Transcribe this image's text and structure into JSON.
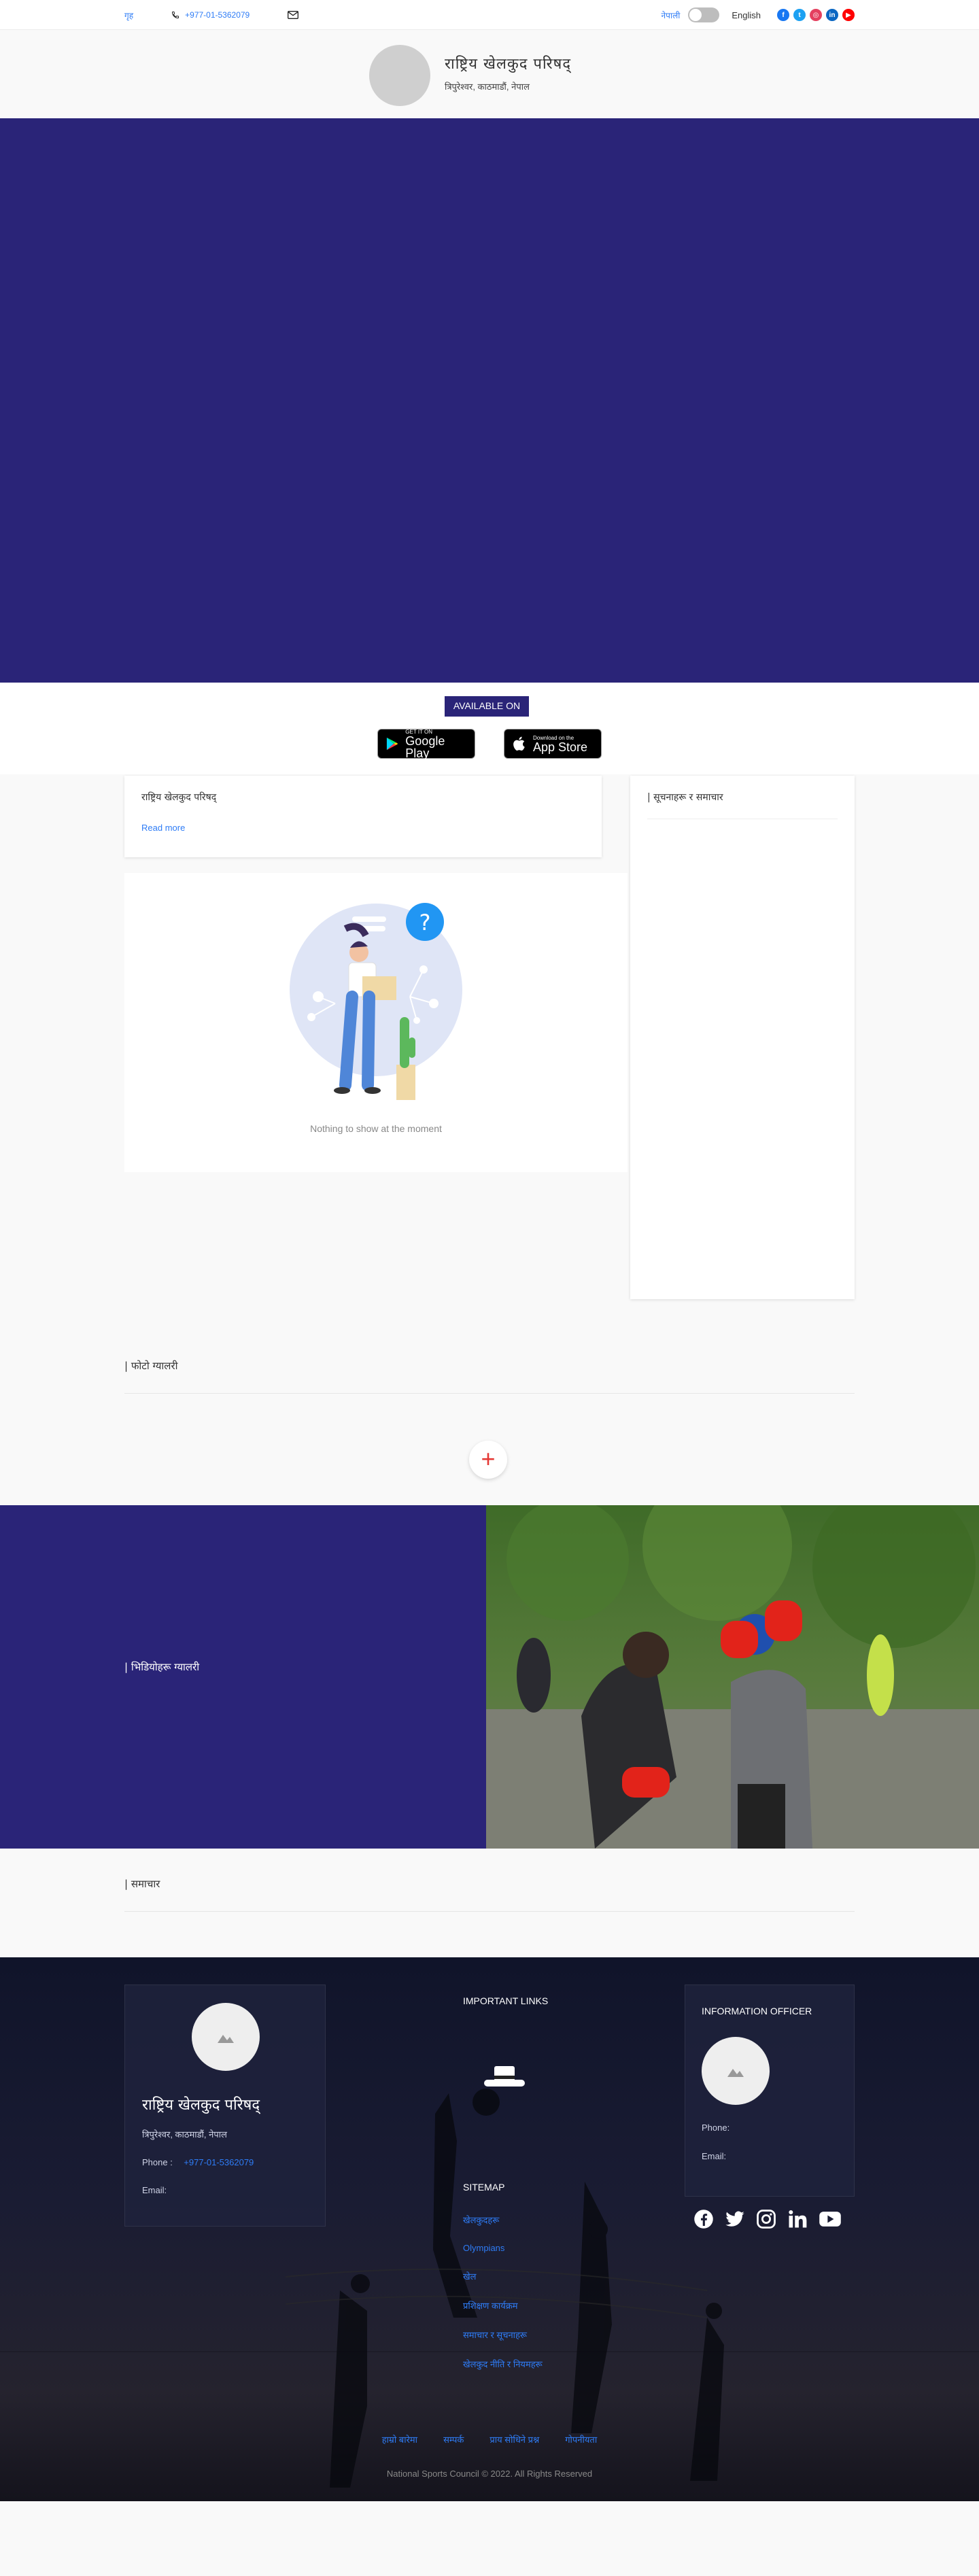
{
  "topbar": {
    "home": "गृह",
    "phone": "+977-01-5362079",
    "lang_native": "नेपाली",
    "lang_english": "English",
    "social": [
      "facebook-icon",
      "twitter-icon",
      "instagram-icon",
      "linkedin-icon",
      "youtube-icon"
    ],
    "social_letters": [
      "f",
      "t",
      "◎",
      "in",
      "▶"
    ],
    "social_colors": [
      "#1877f2",
      "#1da1f2",
      "#e4405f",
      "#0a66c2",
      "#ff0000"
    ]
  },
  "brand": {
    "title": "राष्ट्रिय खेलकुद परिषद्",
    "subtitle": "त्रिपुरेश्वर, काठमाडौं, नेपाल"
  },
  "app": {
    "available": "AVAILABLE ON",
    "google_small": "GET IT ON",
    "google_big": "Google Play",
    "apple_small": "Download on the",
    "apple_big": "App Store"
  },
  "notice": {
    "title": "राष्ट्रिय खेलकुद परिषद्",
    "read_more": "Read more"
  },
  "empty": {
    "text": "Nothing to show at the moment"
  },
  "side": {
    "title": "| सूचनाहरू र समाचार"
  },
  "gallery": {
    "title": "| फोटो ग्यालरी",
    "plus": "+"
  },
  "split": {
    "title": "| भिडियोहरू ग्यालरी"
  },
  "news": {
    "title": "| समाचार"
  },
  "footer": {
    "org_title": "राष्ट्रिय खेलकुद परिषद्",
    "org_address": "त्रिपुरेश्वर, काठमाडौं, नेपाल",
    "phone_label": "Phone :",
    "phone_value": "+977-01-5362079",
    "email_label": "Email:",
    "important_links": "IMPORTANT LINKS",
    "sitemap": "SITEMAP",
    "sitemap_links": [
      "खेलकुदहरू",
      "Olympians",
      "खेल",
      "प्रशिक्षण कार्यक्रम",
      "समाचार र सूचनाहरू",
      "खेलकुद नीति र नियमहरू"
    ],
    "info_officer": "INFORMATION OFFICER",
    "info_phone": "Phone:",
    "info_email": "Email:",
    "bottom_links": [
      "हाम्रो बारेमा",
      "सम्पर्क",
      "प्राय सोधिने प्रश्न",
      "गोपनीयता"
    ],
    "copyright": "National Sports Council © 2022. All Rights Reserved"
  }
}
